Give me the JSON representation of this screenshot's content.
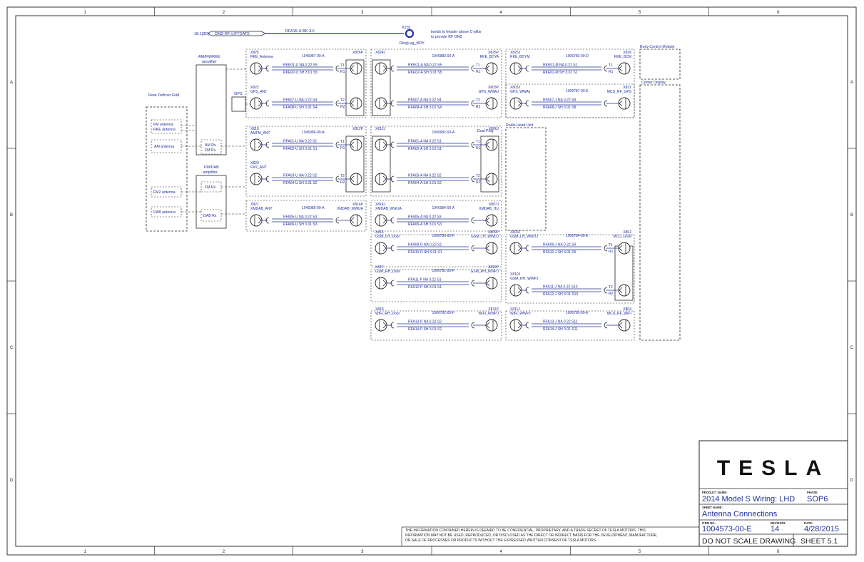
{
  "frame": {
    "columns": [
      "1",
      "2",
      "3",
      "4",
      "5",
      "6"
    ],
    "rows": [
      "A",
      "B",
      "C",
      "D"
    ]
  },
  "rf_header": {
    "ref": "18.1[3D]",
    "connector": "GND-RF-LIFTGATE",
    "wire": "RFA15-U BK 3.0",
    "node_id": "X231",
    "node_label": "RingLug_BDY",
    "note_line1": "bonds to header above C-pillar",
    "note_line2": "to provide RF GND"
  },
  "left_labels": {
    "amfm_title1": "AM/FM/RKE",
    "amfm_title2": "amplifier",
    "fmdab_title1": "FM/DAB",
    "fmdab_title2": "amplifier",
    "rear_defrost": "Rear Defrost Grid",
    "fm_antenna": "FM antenna",
    "rke_antenna": "RKE antenna",
    "am_antenna": "AM antenna",
    "fm2_antenna": "FM2 antenna",
    "dab_antenna": "DAB antenna",
    "gps": "GPS",
    "am_rx": "AM Rx",
    "fm_rx": "FM Rx",
    "fm_rx2": "FM Rx",
    "dab_rx": "DAB Rx"
  },
  "modules": {
    "bcm": "Body Control Module",
    "center_display": "Center Display",
    "radio_head": "Radio Head Unit",
    "dual_plug": "Dual Plug"
  },
  "harness_groups": [
    {
      "pn": "1045987-00-A",
      "left_id": "X825",
      "left_name": "RKE_Antenna",
      "right_id": "X826P",
      "right_name": "",
      "w1": "RKE01-U NA 0.22 S5",
      "w2": "RKE02-U SH 3.01 S5",
      "t1": "T1",
      "t2": "R1"
    },
    {
      "pn": "",
      "left_id": "X822",
      "left_name": "GPS_ANT",
      "right_id": "",
      "right_name": "",
      "w1": "RFA07-U NA 0.22 S4",
      "w2": "RFA08-U SH 3.01 S4",
      "t1": "T2",
      "t2": "R2"
    },
    {
      "pn": "1045983-00-A",
      "left_id": "X824J",
      "left_name": "",
      "right_id": "X825P",
      "right_name": "RKE_BDYA",
      "w1": "RKE01-A NA 0.22 S5",
      "w2": "RKE02-A SH 3.01 S5",
      "t1": "T1",
      "t2": "R1"
    },
    {
      "pn": "",
      "left_id": "",
      "left_name": "",
      "right_id": "X803P",
      "right_name": "GPS_WWAJ",
      "w1": "RFA07-A NA 0.22 S4",
      "w2": "RFA08-A SH 3.01 S4",
      "t1": "T2",
      "t2": "R2"
    },
    {
      "pn": "1006783-00-D",
      "left_id": "X825J",
      "left_name": "RKE_BDYM",
      "right_id": "X828",
      "right_name": "RKE_BCM",
      "w1": "RKE01-M NA 0.22 S1",
      "w2": "RKE02-M SH 3.01 S1",
      "t1": "T1",
      "t2": "R1"
    },
    {
      "pn": "1006787-00-E",
      "left_id": "X803J",
      "left_name": "GPS_WWAJ",
      "right_id": "X831",
      "right_name": "MCU_RF_GPS",
      "w1": "RFA07-J NA 0.22 S8",
      "w2": "RFA08-J SH 3.01 S8",
      "t1": "",
      "t2": ""
    },
    {
      "pn": "1045986-00-A",
      "left_id": "X819",
      "left_name": "AMFM_ANT",
      "right_id": "X812P",
      "right_name": "",
      "w1": "RFA01-U NA 0.22 S1",
      "w2": "RFA02-U SH 3.01 S1",
      "t1": "T1",
      "t2": "R1"
    },
    {
      "pn": "",
      "left_id": "X820",
      "left_name": "FM2_ANT",
      "right_id": "",
      "right_name": "",
      "w1": "RFA03-U NA 0.22 S2",
      "w2": "RFA04-U SH 3.01 S2",
      "t1": "T2",
      "t2": "R2"
    },
    {
      "pn": "1045982-00-A",
      "left_id": "X812J",
      "left_name": "",
      "right_id": "X806J",
      "right_name": "",
      "w1": "RFA01-A NA 0.22 S1",
      "w2": "RFA02-A SH 3.01 S1",
      "t1": "T1",
      "t2": "R1"
    },
    {
      "pn": "",
      "left_id": "",
      "left_name": "",
      "right_id": "",
      "right_name": "",
      "w1": "RFA03-A NA 0.22 S2",
      "w2": "RFA04-A SH 3.01 S2",
      "t1": "T2",
      "t2": "R2"
    },
    {
      "pn": "1045985-00-A",
      "left_id": "X821",
      "left_name": "XMDAB_ANT",
      "right_id": "X814P",
      "right_name": "XMDAB_WWUA",
      "w1": "RFA05-U NA 0.22 S3",
      "w2": "RFA06-U SH 3.01 S3",
      "t1": "",
      "t2": ""
    },
    {
      "pn": "1045984-00-A",
      "left_id": "X814J",
      "left_name": "XMDAB_WWUA",
      "right_id": "X807J",
      "right_name": "XMDAB_HU",
      "w1": "RFA05-A NA 0.22 S3",
      "w2": "RFA06-A SH 3.01 S3",
      "t1": "",
      "t2": ""
    },
    {
      "pn": "1006780-00-F",
      "left_id": "X816",
      "left_name": "GSM_LH_Door",
      "right_id": "X809P",
      "right_name": "GSM_LH_WWDJ",
      "w1": "RFA09-D NA 0.22 S1",
      "w2": "RFA10-D SH 3.01 S1",
      "t1": "",
      "t2": ""
    },
    {
      "pn": "1006784-00-E",
      "left_id": "X809J",
      "left_name": "GSM_LH_WWDJ",
      "right_id": "X802",
      "right_name": "MCU_GSM",
      "w1": "RFA09-J NA 0.22 S9",
      "w2": "RFA10-J SH 3.01 S9",
      "t1": "T1",
      "t2": "R1"
    },
    {
      "pn": "1006781-00-F",
      "left_id": "X817",
      "left_name": "GSM_RH_Door",
      "right_id": "X810P",
      "right_name": "GSM_RH_WWPJ",
      "w1": "RFA11-P NA 0.22 S1",
      "w2": "RFA12-P SH 3.01 S1",
      "t1": "",
      "t2": ""
    },
    {
      "pn": "",
      "left_id": "X810J",
      "left_name": "GSM_RH_WWPJ",
      "right_id": "",
      "right_name": "",
      "w1": "RFA11-J NA 0.22 S10",
      "w2": "RFA12-J SH 3.01 S10",
      "t1": "T2",
      "t2": "R2"
    },
    {
      "pn": "1006782-00-F",
      "left_id": "X818",
      "left_name": "WIFI_RH_Door",
      "right_id": "X811P",
      "right_name": "WIFI_WWPJ",
      "w1": "RFA13-P NA 0.22 S2",
      "w2": "RFA14-P SH 3.01 S2",
      "t1": "",
      "t2": ""
    },
    {
      "pn": "1006785-00-E",
      "left_id": "X811J",
      "left_name": "WIFI_WWPJ",
      "right_id": "X804",
      "right_name": "MCU_RF_WIFI",
      "w1": "RFA13-J NA 0.22 S11",
      "w2": "RFA14-J SH 3.01 S11",
      "t1": "",
      "t2": ""
    }
  ],
  "disclaimer": [
    "THE INFORMATION CONTAINED HEREIN IS DEEMED TO BE CONFIDENTIAL, PROPRIETARY, AND A TRADE SECRET OF TESLA MOTORS. THIS",
    "INFORMATION MAY NOT BE USED, REPRODUCED, OR DISCLOSED AS THE DIRECT OR INDIRECT BASIS FOR THE DEVELOPMENT, MANUFACTURE,",
    "OR SALE OF PROCESSES OR PRODUCTS WITHOUT THE EXPRESSED WRITTEN CONSENT OF TESLA MOTORS."
  ],
  "title_block": {
    "logo": "TESLA",
    "product_label": "PRODUCT NAME:",
    "product": "2014 Model S Wiring: LHD",
    "phase_label": "PHASE:",
    "phase": "SOP6",
    "sheet_name_label": "SHEET NAME:",
    "sheet_name": "Antenna Connections",
    "item_label": "ITEM NO.",
    "item": "1004573-00-E",
    "rev_label": "REVISION:",
    "rev": "14",
    "date_label": "DATE:",
    "date": "4/28/2015",
    "scale_note": "DO NOT SCALE DRAWING",
    "sheet": "SHEET 5.1"
  },
  "colors": {
    "wire_blue": "#1f2f9a",
    "ink": "#222222"
  }
}
